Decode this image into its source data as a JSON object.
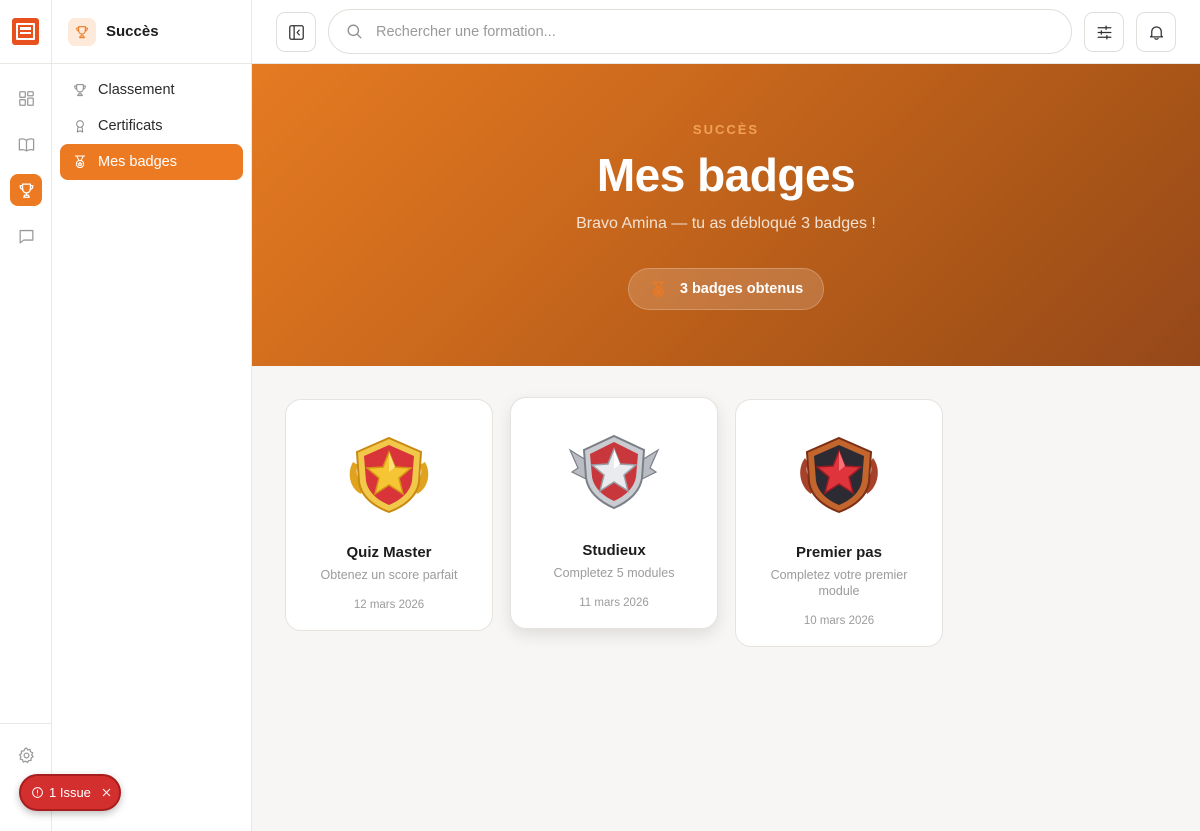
{
  "rail": {
    "items": [
      "dashboard",
      "courses",
      "achievements",
      "messages",
      "settings"
    ],
    "active": "achievements"
  },
  "subnav": {
    "title": "Succès",
    "items": [
      {
        "label": "Classement",
        "icon": "trophy-icon"
      },
      {
        "label": "Certificats",
        "icon": "award-ribbon-icon"
      },
      {
        "label": "Mes badges",
        "icon": "medal-icon",
        "active": true
      }
    ]
  },
  "search": {
    "placeholder": "Rechercher une formation..."
  },
  "hero": {
    "eyebrow": "SUCCÈS",
    "title": "Mes badges",
    "subtitle": "Bravo Amina — tu as débloqué 3 badges !",
    "pill_label": "3 badges obtenus"
  },
  "badges": [
    {
      "name": "Quiz Master",
      "description": "Obtenez un score parfait",
      "date": "12 mars 2026",
      "tier": "gold"
    },
    {
      "name": "Studieux",
      "description": "Completez 5 modules",
      "date": "11 mars 2026",
      "tier": "silver"
    },
    {
      "name": "Premier pas",
      "description": "Completez votre premier module",
      "date": "10 mars 2026",
      "tier": "bronze"
    }
  ],
  "issue": {
    "label": "1 Issue"
  },
  "colors": {
    "accent": "#ec7a22",
    "hero_start": "#e57b22",
    "hero_end": "#96481a",
    "danger": "#d32f2f"
  }
}
